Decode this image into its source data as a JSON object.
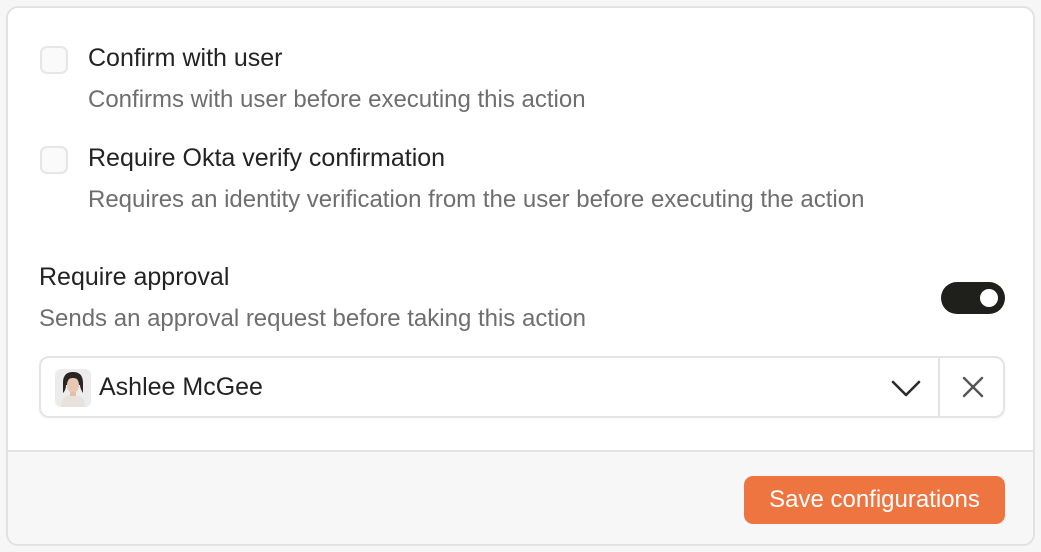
{
  "options": [
    {
      "title": "Confirm with user",
      "description": "Confirms with user before executing this action",
      "checked": false
    },
    {
      "title": "Require Okta verify confirmation",
      "description": "Requires an identity verification from the user before executing the action",
      "checked": false
    }
  ],
  "approval": {
    "title": "Require approval",
    "description": "Sends an approval request before taking this action",
    "enabled": true
  },
  "approver_select": {
    "value": "Ashlee McGee",
    "avatar_icon": "user-avatar",
    "dropdown_icon": "chevron-down-icon",
    "clear_icon": "close-icon"
  },
  "footer": {
    "save_label": "Save configurations",
    "accent_color": "#ee7440"
  }
}
